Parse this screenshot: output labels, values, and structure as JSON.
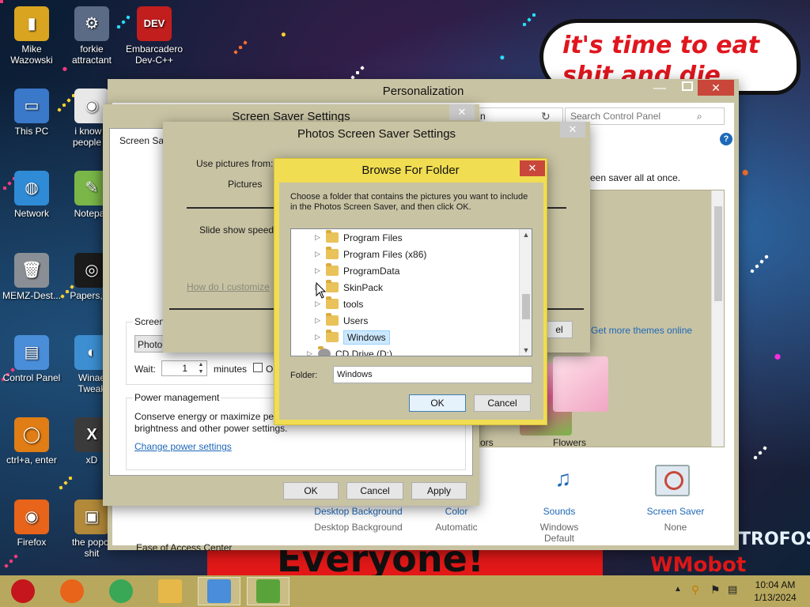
{
  "desktop": {
    "icons": [
      {
        "label": "Mike\nWazowski",
        "color": "#d9a520",
        "glyph": "▮"
      },
      {
        "label": "forkie\nattractant",
        "color": "#5b6b86",
        "glyph": "⚙"
      },
      {
        "label": "Embarcadero\nDev-C++",
        "color": "#c21e1e",
        "glyph": "DEV"
      },
      {
        "label": "This PC",
        "color": "#3a78c9",
        "glyph": "▭"
      },
      {
        "label": "i know y\npeople w",
        "color": "#e8e8e8",
        "glyph": "◉"
      },
      {
        "label": "Network",
        "color": "#2f8bd6",
        "glyph": "◍"
      },
      {
        "label": "Notepac",
        "color": "#7ab648",
        "glyph": "✎"
      },
      {
        "label": "MEMZ-Dest...",
        "color": "#8a8f96",
        "glyph": "🗑"
      },
      {
        "label": "Papers, Pl",
        "color": "#1b1b1b",
        "glyph": "◎"
      },
      {
        "label": "Control Panel",
        "color": "#4a8dd8",
        "glyph": "▤"
      },
      {
        "label": "Winae\nTweak",
        "color": "#3d8fd1",
        "glyph": "◐"
      },
      {
        "label": "ctrl+a, enter",
        "color": "#e07d14",
        "glyph": "◯"
      },
      {
        "label": "xD",
        "color": "#3b3b3b",
        "glyph": "X"
      },
      {
        "label": "Firefox",
        "color": "#e8641a",
        "glyph": "◉"
      },
      {
        "label": "the popcr\nshit",
        "color": "#b28a3a",
        "glyph": "▣"
      }
    ],
    "bubble_text": "it's time to eat shit and die andcelebrate",
    "banner_text": "Everyone!",
    "corner_text": "WMobot",
    "side_text": "TROFOS"
  },
  "personalization": {
    "title": "Personalization",
    "search_placeholder": "Search Control Panel",
    "nav_fragment": "n",
    "help_icon": "?",
    "side_text": "een saver all at once.",
    "get_themes_link": "Get more themes online",
    "theme_preview_label": "Flowers",
    "theme_left_label": "ors",
    "ease_of_access": "Ease of Access Center",
    "bottom_items": [
      {
        "link": "Desktop Background",
        "value": "Desktop Background"
      },
      {
        "link": "Color",
        "value": "Automatic"
      },
      {
        "link": "Sounds",
        "value": "Windows Default"
      },
      {
        "link": "Screen Saver",
        "value": "None"
      }
    ],
    "close_label": "✕"
  },
  "screensaver_settings": {
    "title": "Screen Saver Settings",
    "tab_label": "Screen Sav",
    "group_label": "Screen",
    "selected_saver": "Photo",
    "wait_label": "Wait:",
    "wait_value": "1",
    "minutes_label": "minutes",
    "on_resume_fragment": "On",
    "power_group_label": "Power management",
    "power_text": "Conserve energy or maximize per\nbrightness and other power settings.",
    "change_power_link": "Change power settings",
    "buttons": {
      "ok": "OK",
      "cancel": "Cancel",
      "apply": "Apply"
    },
    "close_label": "✕"
  },
  "photos_settings": {
    "title": "Photos Screen Saver Settings",
    "use_pictures_label": "Use pictures from:",
    "pictures_value": "Pictures",
    "slide_speed_label": "Slide show speed:",
    "customize_link": "How do I customize",
    "cancel_fragment": "el",
    "close_label": "✕"
  },
  "browse_dialog": {
    "title": "Browse For Folder",
    "instruction": "Choose a folder that contains the pictures you want to include in the Photos Screen Saver, and then click OK.",
    "tree": [
      {
        "label": "Program Files",
        "expandable": true,
        "selected": false
      },
      {
        "label": "Program Files (x86)",
        "expandable": true,
        "selected": false
      },
      {
        "label": "ProgramData",
        "expandable": true,
        "selected": false
      },
      {
        "label": "SkinPack",
        "expandable": true,
        "selected": false
      },
      {
        "label": "tools",
        "expandable": true,
        "selected": false
      },
      {
        "label": "Users",
        "expandable": true,
        "selected": false
      },
      {
        "label": "Windows",
        "expandable": true,
        "selected": true
      },
      {
        "label": "CD Drive (D:)",
        "expandable": true,
        "selected": false
      }
    ],
    "folder_label": "Folder:",
    "folder_value": "Windows",
    "ok_label": "OK",
    "cancel_label": "Cancel",
    "close_label": "✕"
  },
  "taskbar": {
    "items": [
      {
        "name": "start-ornament",
        "color": "#c4161c"
      },
      {
        "name": "firefox",
        "color": "#e8641a"
      },
      {
        "name": "chrome",
        "color": "#3aa757"
      },
      {
        "name": "file-explorer",
        "color": "#e6b84a"
      },
      {
        "name": "control-panel",
        "color": "#4a8dd8"
      },
      {
        "name": "personalization",
        "color": "#5aa33a"
      }
    ],
    "time": "10:04 AM",
    "date": "1/13/2024"
  },
  "colors": {
    "window_frame": "#c8c3a3",
    "dialog_frame": "#f1dd52",
    "close_red": "#c8473a",
    "link_blue": "#1d68b8",
    "taskbar": "#b8a85e"
  }
}
